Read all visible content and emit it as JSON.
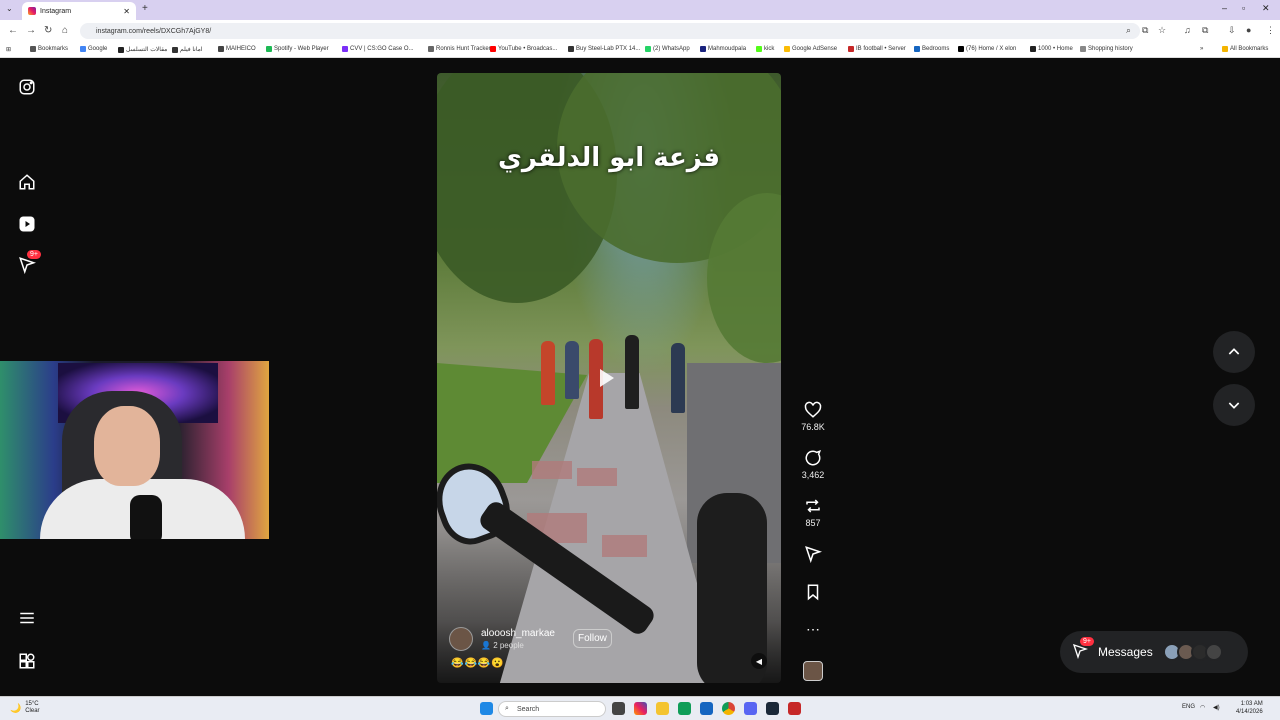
{
  "browser": {
    "tab_title": "Instagram",
    "new_tab": "+",
    "url": "instagram.com/reels/DXCGh7AjGY8/",
    "window_controls": [
      "–",
      "▫",
      "✕"
    ]
  },
  "bookmarks": [
    {
      "label": "Bookmarks",
      "color": "#555"
    },
    {
      "label": "Google",
      "color": "#4285f4"
    },
    {
      "label": "مقالات التسلسل",
      "color": "#222"
    },
    {
      "label": "امانا فيلم",
      "color": "#333"
    },
    {
      "label": "MAIHEICO",
      "color": "#444"
    },
    {
      "label": "Spotify - Web Player",
      "color": "#1db954"
    },
    {
      "label": "CVV | CS:GO Case O...",
      "color": "#7b2ff7"
    },
    {
      "label": "Ronnis Hunt Tracker",
      "color": "#666"
    },
    {
      "label": "YouTube • Broadcas...",
      "color": "#ff0000"
    },
    {
      "label": "Buy Steel-Lab PTX 14...",
      "color": "#333"
    },
    {
      "label": "(2) WhatsApp",
      "color": "#25d366"
    },
    {
      "label": "Mahmoudpala",
      "color": "#1a237e"
    },
    {
      "label": "kick",
      "color": "#53fc18"
    },
    {
      "label": "Google AdSense",
      "color": "#fbbc05"
    },
    {
      "label": "IB football • Server",
      "color": "#c62828"
    },
    {
      "label": "Bedrooms",
      "color": "#1565c0"
    },
    {
      "label": "(76) Home / X elon",
      "color": "#000"
    },
    {
      "label": "1000 • Home",
      "color": "#222"
    },
    {
      "label": "Shopping history",
      "color": "#888"
    }
  ],
  "all_bookmarks": "All Bookmarks",
  "sidebar": {
    "icons": [
      "instagram-logo-icon",
      "home-icon",
      "reels-icon",
      "messages-icon",
      "search-icon",
      "create-icon",
      "profile-icon",
      "menu-icon",
      "more-apps-icon"
    ],
    "notification_badge": "9+"
  },
  "reel": {
    "overlay_text": "فزعة ابو الدلقري",
    "author": "alooosh_markae",
    "people": "2 people",
    "follow_label": "Follow",
    "emojis": "😂😂😂😮"
  },
  "actions": {
    "likes": "76.8K",
    "comments": "3,462",
    "reposts": "857"
  },
  "messages": {
    "label": "Messages",
    "badge": "9+"
  },
  "taskbar": {
    "temp": "15°C",
    "weather": "Clear",
    "search_placeholder": "Search",
    "lang": "ENG",
    "time": "1:03 AM",
    "date": "4/14/2026"
  }
}
